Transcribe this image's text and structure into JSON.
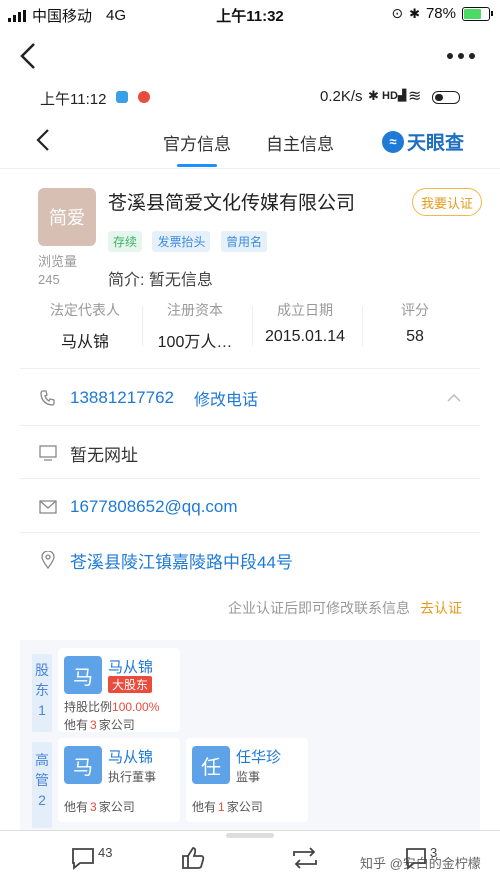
{
  "outer_status": {
    "carrier": "中国移动",
    "network": "4G",
    "time": "上午11:32",
    "battery": "78%",
    "battery_level": 0.78,
    "battery_color": "#4cd964"
  },
  "inner_status": {
    "time": "上午11:12",
    "speed": "0.2K/s"
  },
  "header": {
    "tab_official": "官方信息",
    "tab_self": "自主信息",
    "brand": "天眼查"
  },
  "company": {
    "logo_text": "简爱",
    "views_label": "浏览量",
    "views_count": "245",
    "name": "苍溪县简爱文化传媒有限公司",
    "claim_button": "我要认证",
    "tags": [
      "存续",
      "发票抬头",
      "曾用名"
    ],
    "intro": "简介: 暂无信息"
  },
  "stats": [
    {
      "label": "法定代表人",
      "value": "马从锦"
    },
    {
      "label": "注册资本",
      "value": "100万人…"
    },
    {
      "label": "成立日期",
      "value": "2015.01.14"
    },
    {
      "label": "评分",
      "value": "58"
    }
  ],
  "contact": {
    "phone": "13881217762",
    "edit_phone": "修改电话",
    "website": "暂无网址",
    "email": "1677808652@qq.com",
    "address": "苍溪县陵江镇嘉陵路中段44号",
    "notice": "企业认证后即可修改联系信息",
    "notice_link": "去认证"
  },
  "shareholders": {
    "label_chars": [
      "股",
      "东"
    ],
    "count": "1",
    "items": [
      {
        "avatar": "马",
        "name": "马从锦",
        "badge": "大股东",
        "ratio_label": "持股比例",
        "ratio": "100.00%",
        "other_prefix": "他有",
        "other_count": "3",
        "other_suffix": "家公司"
      }
    ]
  },
  "managers": {
    "label_chars": [
      "高",
      "管"
    ],
    "count": "2",
    "items": [
      {
        "avatar": "马",
        "name": "马从锦",
        "role": "执行董事",
        "other_prefix": "他有",
        "other_count": "3",
        "other_suffix": "家公司"
      },
      {
        "avatar": "任",
        "name": "任华珍",
        "role": "监事",
        "other_prefix": "他有",
        "other_count": "1",
        "other_suffix": "家公司"
      }
    ]
  },
  "bottom_bar": {
    "comments": "43",
    "shares": "3",
    "watermark": "知乎 @安白的金柠檬"
  },
  "colors": {
    "accent": "#1e7ad6",
    "tag_green": "#3bb46a",
    "tag_blue": "#3d8bdb",
    "badge_red": "#e94b3c"
  }
}
